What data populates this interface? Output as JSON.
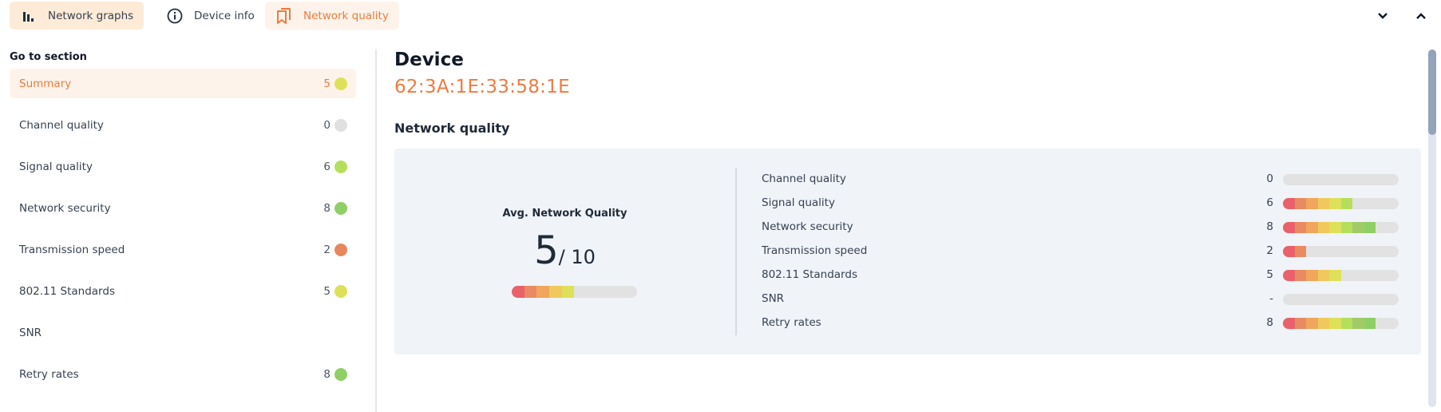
{
  "tabs": [
    {
      "label": "Network graphs",
      "icon": "bar-chart-icon",
      "state": "selected"
    },
    {
      "label": "Device info",
      "icon": "info-icon",
      "state": "normal"
    },
    {
      "label": "Network quality",
      "icon": "bookmarks-icon",
      "state": "active"
    }
  ],
  "header_controls": {
    "collapse_icon": "chevron-down-icon",
    "expand_icon": "chevron-up-icon"
  },
  "sidebar": {
    "title": "Go to section",
    "items": [
      {
        "label": "Summary",
        "value": "5",
        "color": "#dee05a",
        "active": true
      },
      {
        "label": "Channel quality",
        "value": "0",
        "color": "#e0e0e0",
        "active": false
      },
      {
        "label": "Signal quality",
        "value": "6",
        "color": "#b5df5a",
        "active": false
      },
      {
        "label": "Network security",
        "value": "8",
        "color": "#8fcf66",
        "active": false
      },
      {
        "label": "Transmission speed",
        "value": "2",
        "color": "#e8875e",
        "active": false
      },
      {
        "label": "802.11 Standards",
        "value": "5",
        "color": "#dee05a",
        "active": false
      },
      {
        "label": "SNR",
        "value": "",
        "color": "",
        "active": false
      },
      {
        "label": "Retry rates",
        "value": "8",
        "color": "#8fcf66",
        "active": false
      }
    ]
  },
  "main": {
    "title": "Device",
    "mac": "62:3A:1E:33:58:1E",
    "section_title": "Network quality",
    "avg": {
      "label": "Avg. Network Quality",
      "score": "5",
      "max_label": "/ 10",
      "value": 5,
      "max": 10
    },
    "metrics": [
      {
        "label": "Channel quality",
        "value_text": "0",
        "value": 0
      },
      {
        "label": "Signal quality",
        "value_text": "6",
        "value": 6
      },
      {
        "label": "Network security",
        "value_text": "8",
        "value": 8
      },
      {
        "label": "Transmission speed",
        "value_text": "2",
        "value": 2
      },
      {
        "label": "802.11 Standards",
        "value_text": "5",
        "value": 5
      },
      {
        "label": "SNR",
        "value_text": "-",
        "value": 0
      },
      {
        "label": "Retry rates",
        "value_text": "8",
        "value": 8
      }
    ]
  },
  "colors": {
    "accent": "#f07a3c",
    "segment_scale": [
      "#e8616b",
      "#e98b62",
      "#f0a65c",
      "#f0c95c",
      "#dee05a",
      "#b5df5a",
      "#a2cb68",
      "#8fcf66",
      "#7cc46a",
      "#6ab86d"
    ]
  }
}
